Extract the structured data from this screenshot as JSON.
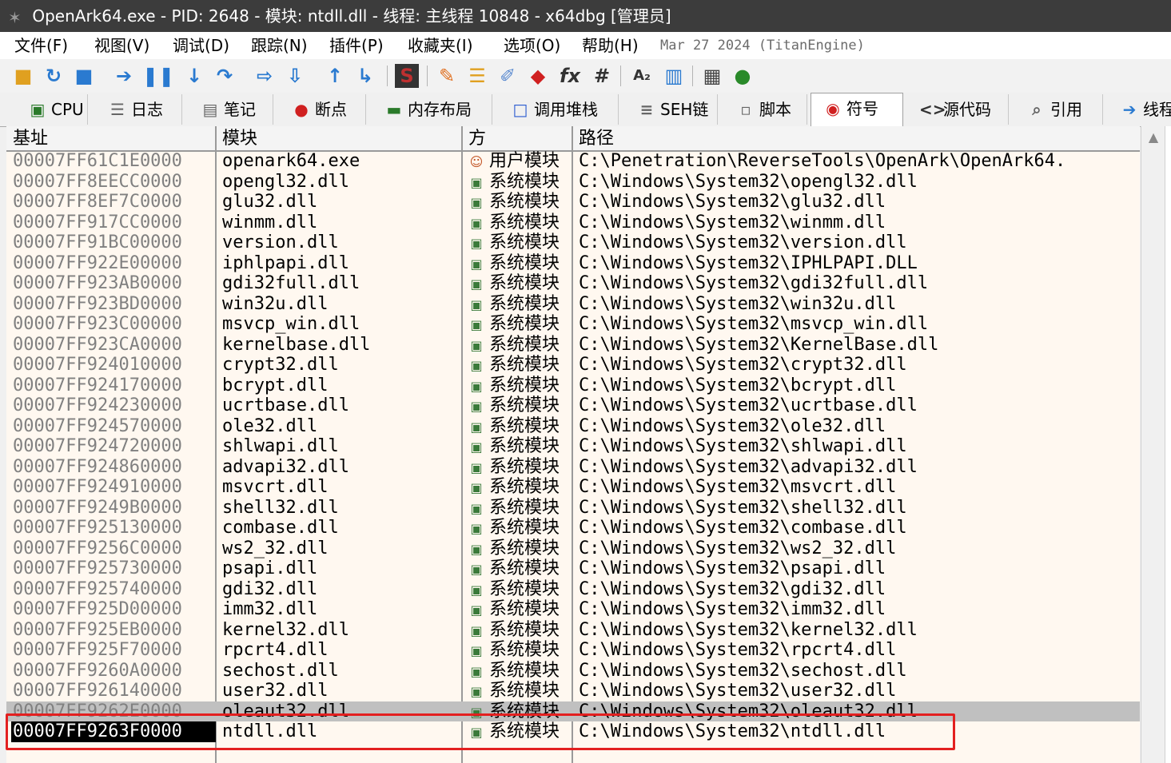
{
  "window": {
    "title": "OpenArk64.exe - PID: 2648 - 模块: ntdll.dll - 线程: 主线程 10848 - x64dbg [管理员]"
  },
  "menu": {
    "items": [
      "文件(F)",
      "视图(V)",
      "调试(D)",
      "跟踪(N)",
      "插件(P)",
      "收藏夹(I)",
      "选项(O)",
      "帮助(H)"
    ],
    "version": "Mar 27 2024 (TitanEngine)"
  },
  "toolbar": {
    "icons": [
      "open-icon",
      "restart-icon",
      "stop-icon",
      "run-icon",
      "pause-icon",
      "step-into-icon",
      "step-over-icon",
      "trace-into-icon",
      "trace-over-icon",
      "execute-till-return-icon",
      "run-to-user-code-icon",
      "scylla-icon",
      "patch-icon",
      "comment-icon",
      "label-icon",
      "bookmark-icon",
      "function-icon",
      "hash-icon",
      "font-icon",
      "memory-icon",
      "calculator-icon",
      "globe-icon"
    ]
  },
  "tabs": [
    {
      "label": "CPU",
      "icon": "cpu-icon"
    },
    {
      "label": "日志",
      "icon": "log-icon"
    },
    {
      "label": "笔记",
      "icon": "notes-icon"
    },
    {
      "label": "断点",
      "icon": "breakpoint-icon"
    },
    {
      "label": "内存布局",
      "icon": "memory-map-icon"
    },
    {
      "label": "调用堆栈",
      "icon": "call-stack-icon"
    },
    {
      "label": "SEH链",
      "icon": "seh-icon"
    },
    {
      "label": "脚本",
      "icon": "script-icon"
    },
    {
      "label": "符号",
      "icon": "symbol-icon"
    },
    {
      "label": "源代码",
      "icon": "source-icon"
    },
    {
      "label": "引用",
      "icon": "references-icon"
    },
    {
      "label": "线程",
      "icon": "threads-icon"
    }
  ],
  "table": {
    "columns": [
      "基址",
      "模块",
      "方",
      "路径"
    ],
    "rows": [
      {
        "base": "00007FF61C1E0000",
        "module": "openark64.exe",
        "type": "用户模块",
        "path": "C:\\Penetration\\ReverseTools\\OpenArk\\OpenArk64."
      },
      {
        "base": "00007FF8EECC0000",
        "module": "opengl32.dll",
        "type": "系统模块",
        "path": "C:\\Windows\\System32\\opengl32.dll"
      },
      {
        "base": "00007FF8EF7C0000",
        "module": "glu32.dll",
        "type": "系统模块",
        "path": "C:\\Windows\\System32\\glu32.dll"
      },
      {
        "base": "00007FF917CC0000",
        "module": "winmm.dll",
        "type": "系统模块",
        "path": "C:\\Windows\\System32\\winmm.dll"
      },
      {
        "base": "00007FF91BC00000",
        "module": "version.dll",
        "type": "系统模块",
        "path": "C:\\Windows\\System32\\version.dll"
      },
      {
        "base": "00007FF922E00000",
        "module": "iphlpapi.dll",
        "type": "系统模块",
        "path": "C:\\Windows\\System32\\IPHLPAPI.DLL"
      },
      {
        "base": "00007FF923AB0000",
        "module": "gdi32full.dll",
        "type": "系统模块",
        "path": "C:\\Windows\\System32\\gdi32full.dll"
      },
      {
        "base": "00007FF923BD0000",
        "module": "win32u.dll",
        "type": "系统模块",
        "path": "C:\\Windows\\System32\\win32u.dll"
      },
      {
        "base": "00007FF923C00000",
        "module": "msvcp_win.dll",
        "type": "系统模块",
        "path": "C:\\Windows\\System32\\msvcp_win.dll"
      },
      {
        "base": "00007FF923CA0000",
        "module": "kernelbase.dll",
        "type": "系统模块",
        "path": "C:\\Windows\\System32\\KernelBase.dll"
      },
      {
        "base": "00007FF924010000",
        "module": "crypt32.dll",
        "type": "系统模块",
        "path": "C:\\Windows\\System32\\crypt32.dll"
      },
      {
        "base": "00007FF924170000",
        "module": "bcrypt.dll",
        "type": "系统模块",
        "path": "C:\\Windows\\System32\\bcrypt.dll"
      },
      {
        "base": "00007FF924230000",
        "module": "ucrtbase.dll",
        "type": "系统模块",
        "path": "C:\\Windows\\System32\\ucrtbase.dll"
      },
      {
        "base": "00007FF924570000",
        "module": "ole32.dll",
        "type": "系统模块",
        "path": "C:\\Windows\\System32\\ole32.dll"
      },
      {
        "base": "00007FF924720000",
        "module": "shlwapi.dll",
        "type": "系统模块",
        "path": "C:\\Windows\\System32\\shlwapi.dll"
      },
      {
        "base": "00007FF924860000",
        "module": "advapi32.dll",
        "type": "系统模块",
        "path": "C:\\Windows\\System32\\advapi32.dll"
      },
      {
        "base": "00007FF924910000",
        "module": "msvcrt.dll",
        "type": "系统模块",
        "path": "C:\\Windows\\System32\\msvcrt.dll"
      },
      {
        "base": "00007FF9249B0000",
        "module": "shell32.dll",
        "type": "系统模块",
        "path": "C:\\Windows\\System32\\shell32.dll"
      },
      {
        "base": "00007FF925130000",
        "module": "combase.dll",
        "type": "系统模块",
        "path": "C:\\Windows\\System32\\combase.dll"
      },
      {
        "base": "00007FF9256C0000",
        "module": "ws2_32.dll",
        "type": "系统模块",
        "path": "C:\\Windows\\System32\\ws2_32.dll"
      },
      {
        "base": "00007FF925730000",
        "module": "psapi.dll",
        "type": "系统模块",
        "path": "C:\\Windows\\System32\\psapi.dll"
      },
      {
        "base": "00007FF925740000",
        "module": "gdi32.dll",
        "type": "系统模块",
        "path": "C:\\Windows\\System32\\gdi32.dll"
      },
      {
        "base": "00007FF925D00000",
        "module": "imm32.dll",
        "type": "系统模块",
        "path": "C:\\Windows\\System32\\imm32.dll"
      },
      {
        "base": "00007FF925EB0000",
        "module": "kernel32.dll",
        "type": "系统模块",
        "path": "C:\\Windows\\System32\\kernel32.dll"
      },
      {
        "base": "00007FF925F70000",
        "module": "rpcrt4.dll",
        "type": "系统模块",
        "path": "C:\\Windows\\System32\\rpcrt4.dll"
      },
      {
        "base": "00007FF9260A0000",
        "module": "sechost.dll",
        "type": "系统模块",
        "path": "C:\\Windows\\System32\\sechost.dll"
      },
      {
        "base": "00007FF926140000",
        "module": "user32.dll",
        "type": "系统模块",
        "path": "C:\\Windows\\System32\\user32.dll"
      },
      {
        "base": "00007FF9262E0000",
        "module": "oleaut32.dll",
        "type": "系统模块",
        "path": "C:\\Windows\\System32\\oleaut32.dll"
      },
      {
        "base": "00007FF9263F0000",
        "module": "ntdll.dll",
        "type": "系统模块",
        "path": "C:\\Windows\\System32\\ntdll.dll"
      }
    ]
  },
  "colors": {
    "titlebar": "#3c3c3c",
    "table_background": "#fff8f0",
    "highlight_box": "#e32020",
    "selected_row": "#c0c0c0"
  }
}
